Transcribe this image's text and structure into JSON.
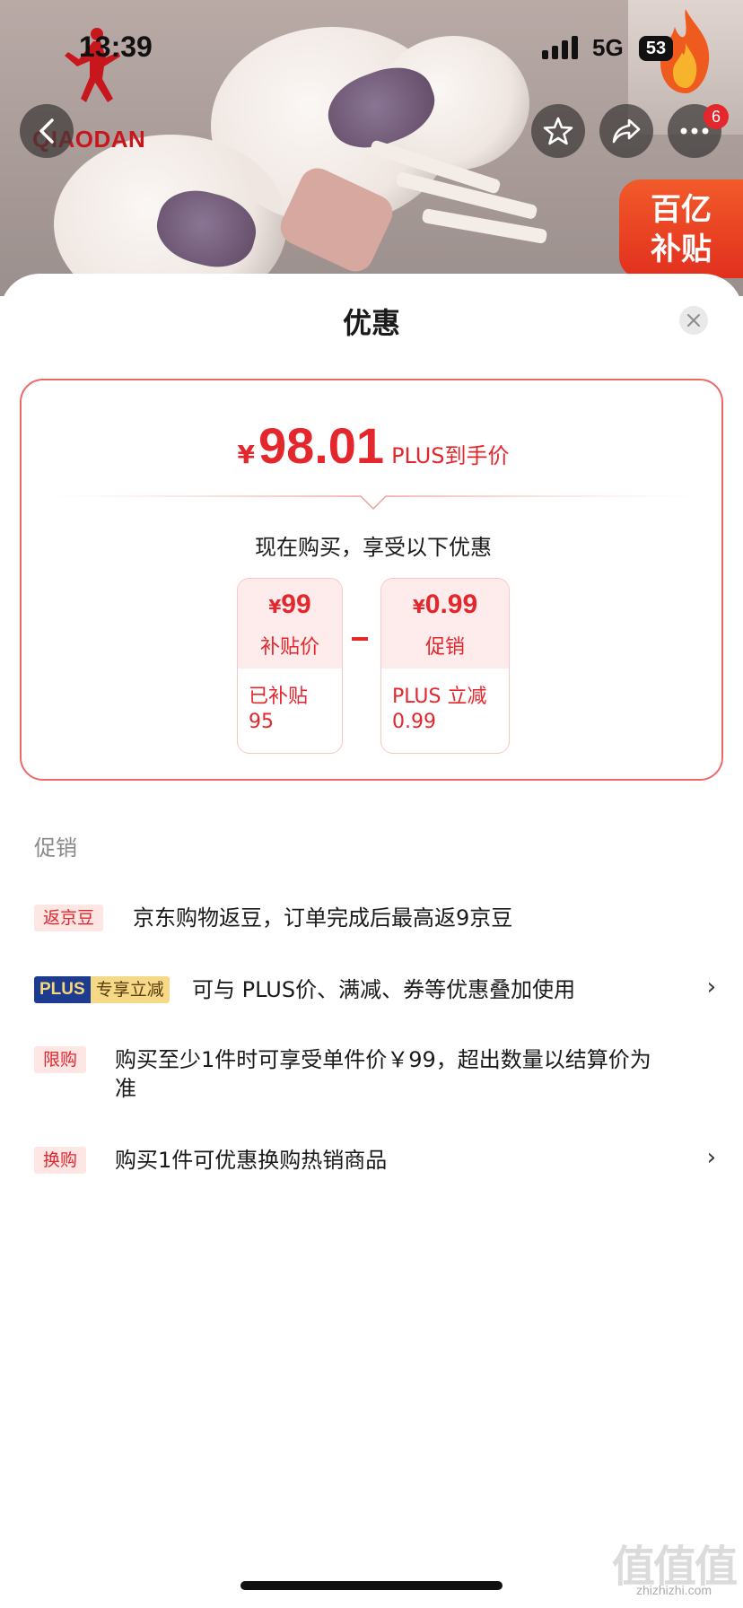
{
  "status_bar": {
    "time": "13:39",
    "network": "5G",
    "battery": "53"
  },
  "brand": {
    "name": "QIAODAN",
    "color": "#c8161d"
  },
  "nav": {
    "cart_badge": "6"
  },
  "subsidy_tag": {
    "line1": "百亿",
    "line2": "补贴"
  },
  "sheet": {
    "title": "优惠",
    "price": {
      "currency": "¥",
      "amount": "98.01",
      "label": "PLUS到手价"
    },
    "now_buy": "现在购买，享受以下优惠",
    "cards": [
      {
        "currency": "¥",
        "value": "99",
        "label": "补贴价",
        "desc": "已补贴 95"
      },
      {
        "currency": "¥",
        "value": "0.99",
        "label": "促销",
        "desc": "PLUS 立减 0.99"
      }
    ]
  },
  "promotions": {
    "section_title": "促销",
    "items": [
      {
        "tag": "返京豆",
        "text": "京东购物返豆，订单完成后最高返9京豆"
      },
      {
        "tag_plus": "PLUS",
        "tag_plus_sub": "专享立减",
        "text": "可与 PLUS价、满减、券等优惠叠加使用",
        "chevron": "›"
      },
      {
        "tag": "限购",
        "text": "购买至少1件时可享受单件价￥99，超出数量以结算价为准"
      },
      {
        "tag": "换购",
        "text": "购买1件可优惠换购热销商品",
        "chevron": "›"
      }
    ]
  },
  "watermark": {
    "main": "值值值",
    "sub": "zhizhizhi.com"
  },
  "colors": {
    "accent": "#e4262d",
    "card_border": "#ea6b66",
    "plus_blue": "#1d3b8f",
    "plus_gold": "#f5d987"
  }
}
